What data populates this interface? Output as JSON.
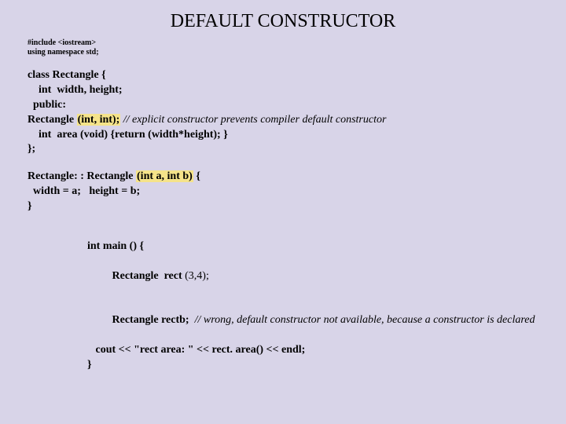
{
  "title": "DEFAULT CONSTRUCTOR",
  "preamble": {
    "l1": "#include <iostream>",
    "l2": "using namespace std;"
  },
  "block1": {
    "l1": "class  Rectangle {",
    "l2": "    int  width, height;",
    "l3": "  public:",
    "l4a": "Rectangle ",
    "l4b": "(int, int);",
    "l4c": "   // explicit constructor prevents compiler default constructor",
    "l5": "    int  area (void) {return (width*height); }",
    "l6": "};"
  },
  "block2": {
    "l1a": "Rectangle: : Rectangle ",
    "l1b": "(int a, int b)",
    "l1c": " {",
    "l2": "  width = a;   height = b;",
    "l3": "}"
  },
  "block3": {
    "l1": "int main () {",
    "l2a": "   Rectangle  rect ",
    "l2b": "(3,4);",
    "l3a": "   Rectangle rectb;",
    "l3b": "  // wrong, default constructor not available, because a constructor is declared",
    "l4": "   cout << \"rect area: \" << rect. area() << endl;",
    "l5": "}"
  }
}
